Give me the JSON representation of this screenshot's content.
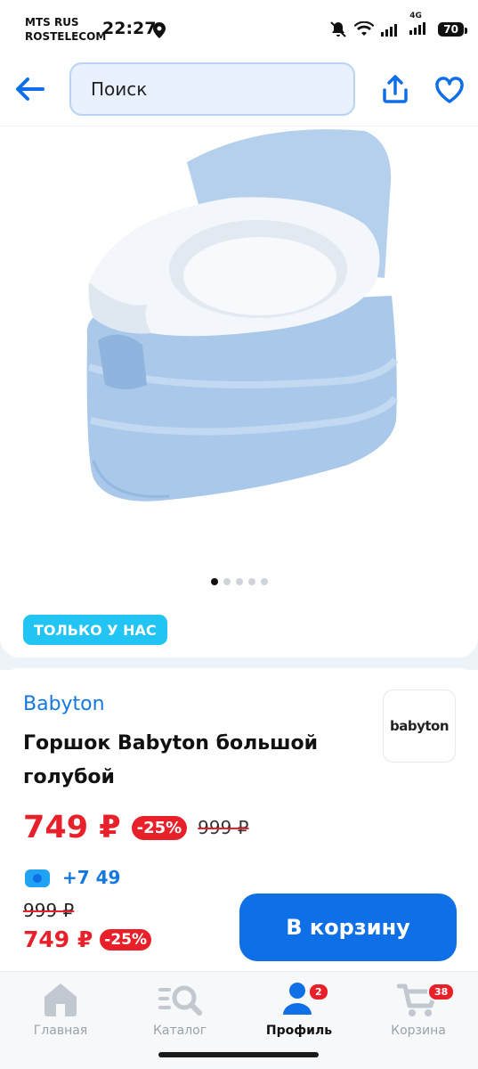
{
  "status_bar": {
    "carrier_line1": "MTS RUS",
    "carrier_line2": "ROSTELECOM",
    "time": "22:27",
    "network": "4G",
    "battery": "70"
  },
  "header": {
    "search_placeholder": "Поиск"
  },
  "gallery": {
    "image_count": 5,
    "active_index": 0,
    "badge": "ТОЛЬКО У НАС"
  },
  "product": {
    "brand": "Babyton",
    "brand_logo_text": "babyton",
    "title": "Горшок Babyton большой голубой",
    "price": "749 ₽",
    "discount": "-25%",
    "old_price": "999 ₽",
    "bonus": "+7 49"
  },
  "buy_bar": {
    "old_price": "999 ₽",
    "price": "749 ₽",
    "discount": "-25%",
    "cart_button": "В корзину"
  },
  "tabbar": {
    "items": [
      {
        "label": "Главная",
        "icon": "home-icon"
      },
      {
        "label": "Каталог",
        "icon": "catalog-search-icon"
      },
      {
        "label": "Профиль",
        "icon": "profile-icon",
        "badge": "2"
      },
      {
        "label": "Корзина",
        "icon": "cart-icon",
        "badge": "38"
      }
    ],
    "active_index": 2
  },
  "colors": {
    "accent_blue": "#0f6fe6",
    "price_red": "#e8202a",
    "badge_cyan": "#21c4f3"
  }
}
